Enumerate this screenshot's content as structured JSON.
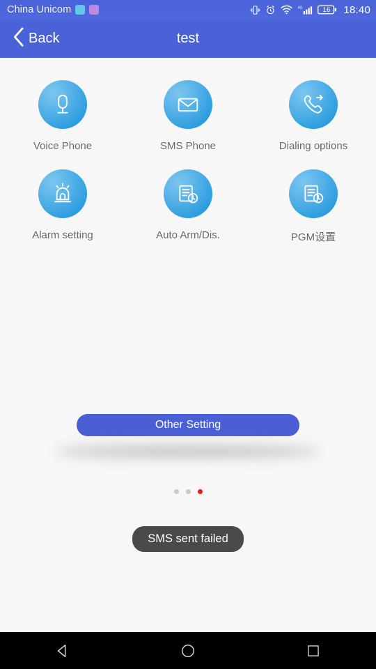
{
  "status_bar": {
    "carrier": "China Unicom",
    "mini_icons": [
      "app-badge-cyan-icon",
      "app-badge-violet-icon"
    ],
    "right_icons": [
      "vibrate-icon",
      "alarm-clock-icon",
      "wifi-icon",
      "signal-4g-icon"
    ],
    "battery_level": "16",
    "network_label": "4G",
    "clock": "18:40"
  },
  "title_bar": {
    "back_label": "Back",
    "title": "test"
  },
  "grid": {
    "tiles": [
      {
        "label": "Voice Phone",
        "icon": "microphone-icon"
      },
      {
        "label": "SMS Phone",
        "icon": "envelope-icon"
      },
      {
        "label": "Dialing options",
        "icon": "phone-forward-icon"
      },
      {
        "label": "Alarm setting",
        "icon": "siren-icon"
      },
      {
        "label": "Auto Arm/Dis.",
        "icon": "document-clock-icon"
      },
      {
        "label": "PGM设置",
        "icon": "document-clock-icon"
      }
    ]
  },
  "footer": {
    "other_setting_label": "Other Setting"
  },
  "pager": {
    "dots": 3,
    "active_index": 2,
    "active_color": "#e01c1c",
    "inactive_color": "#c9c9c9"
  },
  "toast": {
    "message": "SMS sent failed"
  },
  "nav_bar": {
    "buttons": [
      "back-triangle-icon",
      "home-circle-icon",
      "recents-square-icon"
    ]
  },
  "colors": {
    "header": "#4a62d8",
    "page_background": "#f7f7f7",
    "icon_blue_light": "#7cc6ef",
    "icon_blue_dark": "#1b8ed6",
    "button_blue": "#4a5fd4",
    "toast_background": "#4a4a4a",
    "label_gray": "#666a6e"
  }
}
